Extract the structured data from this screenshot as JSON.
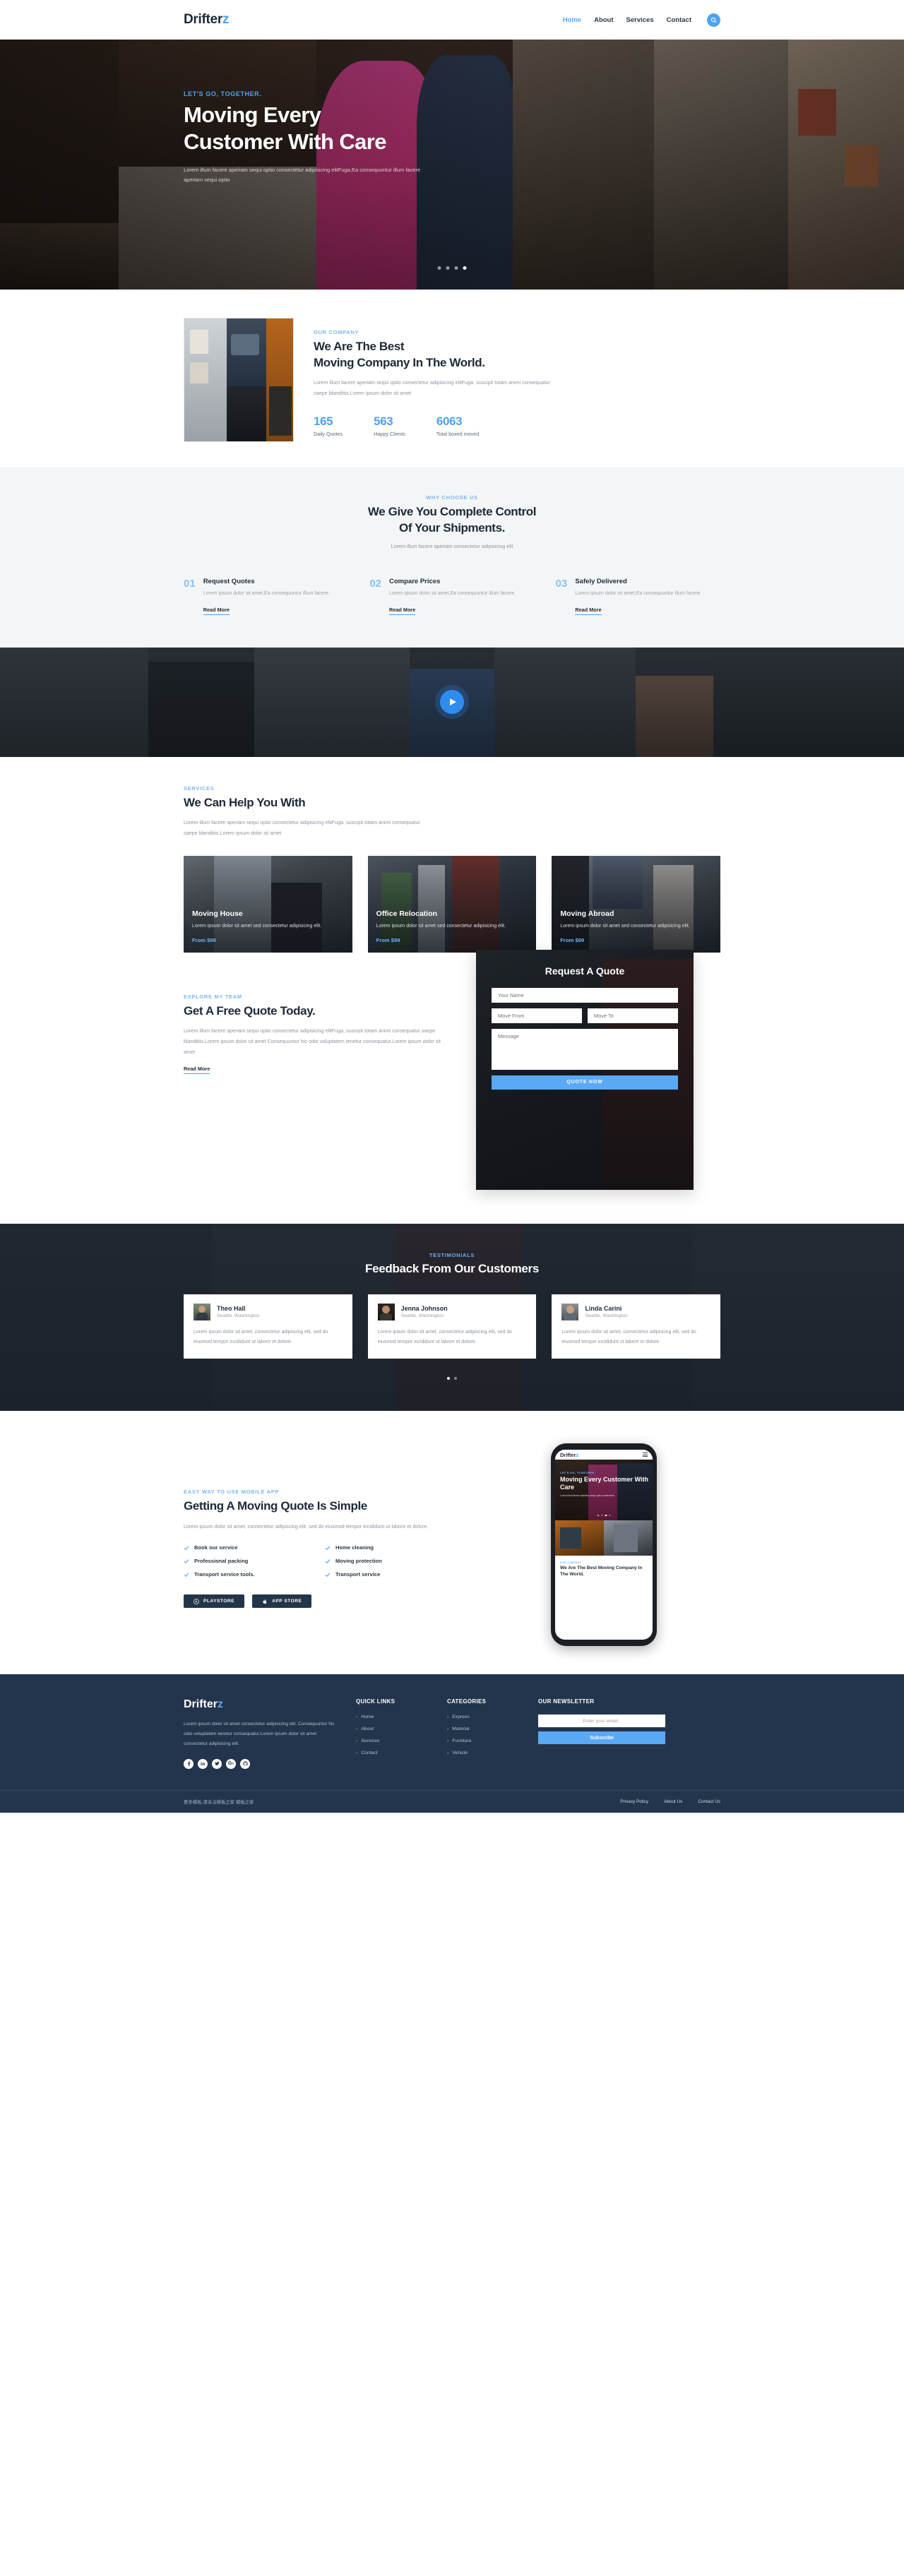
{
  "brand": {
    "name": "Drifter",
    "accent_letter": "z",
    "accent_color": "#4ea2f3"
  },
  "header": {
    "nav": [
      {
        "label": "Home",
        "active": true
      },
      {
        "label": "About",
        "active": false
      },
      {
        "label": "Services",
        "active": false
      },
      {
        "label": "Contact",
        "active": false
      }
    ],
    "search_icon": "search-icon"
  },
  "hero": {
    "kicker": "LET'S GO, TOGETHER.",
    "title_line1": "Moving Every",
    "title_line2": "Customer With Care",
    "subtitle": "Lorem illum facere aperiam sequi optio consectetur adipisicing elitFuga,Ea consequuntur illum facere aperiam sequi optio",
    "slide_count": 4,
    "active_slide": 4
  },
  "about": {
    "kicker": "OUR COMPANY",
    "title_line1": "We Are The Best",
    "title_line2": "Moving Company In The World.",
    "text": "Lorem illum facere aperiam sequi optio consectetur adipisicing elitFuga, suscipit totam animi consequatur saepe blanditiis.Lorem ipsum dolor sit amet",
    "stats": [
      {
        "value": "165",
        "label": "Daily Quotes"
      },
      {
        "value": "563",
        "label": "Happy Clients"
      },
      {
        "value": "6063",
        "label": "Total boxed moved"
      }
    ]
  },
  "why": {
    "kicker": "WHY CHOOSE US",
    "title_line1": "We Give You Complete Control",
    "title_line2": "Of Your Shipments.",
    "subtitle": "Lorem illum facere aperiam consectetur adipisicing elit",
    "steps": [
      {
        "num": "01",
        "title": "Request Quotes",
        "text": "Lorem ipsum dolor sit amet,Ea consequuntur illum facere.",
        "link": "Read More"
      },
      {
        "num": "02",
        "title": "Compare Prices",
        "text": "Lorem ipsum dolor sit amet,Ea consequuntur illum facere.",
        "link": "Read More"
      },
      {
        "num": "03",
        "title": "Safely Delivered",
        "text": "Lorem ipsum dolor sit amet,Ea consequuntur illum facere.",
        "link": "Read More"
      }
    ]
  },
  "video": {
    "play_icon": "play-icon"
  },
  "services": {
    "kicker": "SERVICES",
    "title": "We Can Help You With",
    "text": "Lorem illum facere aperiam sequi optio consectetur adipisicing elitFuga, suscipit totam animi consequatur saepe blanditiis.Lorem ipsum dolor sit amet",
    "cards": [
      {
        "title": "Moving House",
        "desc": "Lorem ipsum dolor sit amet sed consectetur adipisicing elit.",
        "price": "From $99"
      },
      {
        "title": "Office Relocation",
        "desc": "Lorem ipsum dolor sit amet sed consectetur adipisicing elit.",
        "price": "From $99"
      },
      {
        "title": "Moving Abroad",
        "desc": "Lorem ipsum dolor sit amet sed consectetur adipisicing elit.",
        "price": "From $99"
      }
    ]
  },
  "quote": {
    "kicker": "EXPLORE MY TEAM",
    "title": "Get A Free Quote Today.",
    "text": "Lorem illum facere aperiam sequi optio consectetur adipisicing elitFuga, suscipit totam animi consequatur saepe blanditiis.Lorem ipsum dolor sit amet Consequuntur hic odio voluptatem tenetur consequatur.Lorem ipsum dolor sit amet",
    "link": "Read More",
    "form": {
      "title": "Request A Quote",
      "name_placeholder": "Your Name",
      "from_placeholder": "Move From",
      "to_placeholder": "Move To",
      "message_placeholder": "Message",
      "submit_label": "QUOTE NOW"
    }
  },
  "testimonials": {
    "kicker": "TESTIMONIALS",
    "title": "Feedback From Our Customers",
    "items": [
      {
        "name": "Theo Hall",
        "location": "Seattle, Washington",
        "text": "Lorem ipsum dolor sit amet, consectetur adipiscing elit, sed do eiusmod tempor incididunt ut labore et dolore."
      },
      {
        "name": "Jenna Johnson",
        "location": "Seattle, Washington",
        "text": "Lorem ipsum dolor sit amet, consectetur adipiscing elit, sed do eiusmod tempor incididunt ut labore et dolore."
      },
      {
        "name": "Linda Carini",
        "location": "Seattle, Washington",
        "text": "Lorem ipsum dolor sit amet, consectetur adipiscing elit, sed do eiusmod tempor incididunt ut labore et dolore."
      }
    ],
    "slide_count": 2,
    "active_slide": 1
  },
  "app": {
    "kicker": "EASY WAY TO USE MOBILE APP",
    "title": "Getting A Moving Quote Is Simple",
    "text": "Lorem ipsum dolor sit amet, consectetur adipiscing elit, sed do eiusmod tempor incididunt ut labore et dolore.",
    "features": [
      "Book our service",
      "Home cleaning",
      "Professional packing",
      "Moving protection",
      "Transport service tools.",
      "Transport service"
    ],
    "buttons": [
      {
        "label": "PLAYSTORE",
        "icon": "playstore-icon"
      },
      {
        "label": "APP STORE",
        "icon": "apple-icon"
      }
    ],
    "phone": {
      "logo": "Drifter",
      "logo_accent": "z",
      "hero_kicker": "LET'S GO, TOGETHER.",
      "hero_title": "Moving Every Customer With Care",
      "hero_sub": "Lorem illum facere aperiam sequi optio consectetur",
      "about_kicker": "OUR COMPANY",
      "about_title": "We Are The Best Moving Company In The World."
    }
  },
  "footer": {
    "brand_text": "Lorem ipsum dolor sit amet consectetur adipisicing elit. Consequuntur hic odio voluptatem tenetur consequatur.Lorem ipsum dolor sit amet consectetur adipisicing elit.",
    "social": [
      "facebook-icon",
      "linkedin-icon",
      "twitter-icon",
      "googleplus-icon",
      "github-icon"
    ],
    "quick_links_title": "QUICK LINKS",
    "quick_links": [
      "Home",
      "About",
      "Services",
      "Contact"
    ],
    "categories_title": "CATEGORIES",
    "categories": [
      "Express",
      "Material",
      "Furniture",
      "Vehicle"
    ],
    "newsletter_title": "OUR NEWSLETTER",
    "newsletter_placeholder": "Enter your email..",
    "subscribe_label": "Subscribe",
    "copyright": "更多模板,请关注模板之家 模板之家",
    "bottom_links": [
      "Privacy Policy",
      "About Us",
      "Contact Us"
    ]
  }
}
